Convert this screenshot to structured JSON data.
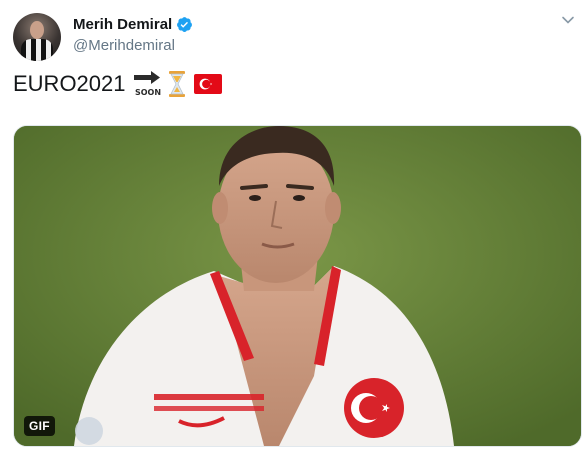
{
  "author": {
    "name": "Merih Demiral",
    "handle": "@Merihdemiral",
    "verified": true
  },
  "tweet": {
    "text": "EURO2021",
    "emojis": [
      "soon-arrow-emoji",
      "hourglass-emoji",
      "turkey-flag-emoji"
    ],
    "soon_label": "SOON"
  },
  "media": {
    "type": "gif",
    "badge": "GIF"
  },
  "colors": {
    "verified_blue": "#1da1f2",
    "handle_gray": "#657786",
    "flag_red": "#e30a17"
  }
}
